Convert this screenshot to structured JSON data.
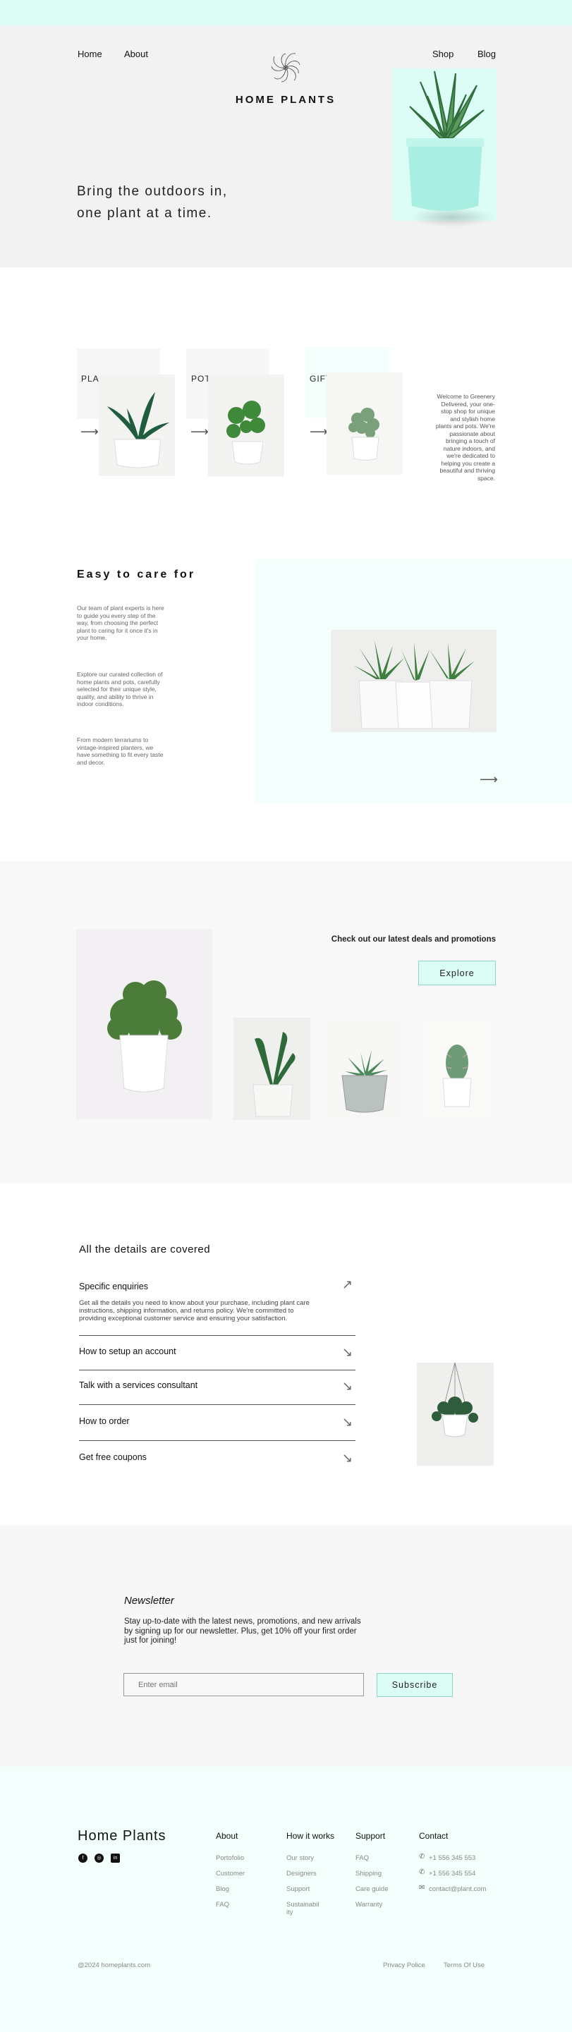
{
  "header": {
    "nav_left": [
      "Home",
      "About"
    ],
    "nav_right": [
      "Shop",
      "Blog"
    ],
    "brand": "HOME PLANTS",
    "tagline_line1": "Bring the outdoors in,",
    "tagline_line2": "one plant at a time."
  },
  "categories": [
    {
      "label": "PLANTS"
    },
    {
      "label": "POTS"
    },
    {
      "label": "GIFTS"
    }
  ],
  "welcome_text": "Welcome to Greenery Delivered, your one-stop shop for unique and stylish home plants and pots. We're passionate about bringing a touch of nature indoors, and we're dedicated to helping you create a beautiful and thriving space.",
  "care": {
    "title": "Easy to care for",
    "para1": "Our team of plant experts is here to guide you every step of the way, from choosing the perfect plant to caring for it once it's in your home.",
    "para2": "Explore our curated collection of home plants and pots, carefully selected for their unique style, quality, and ability to thrive in indoor conditions.",
    "para3": "From modern terrariums to vintage-inspired planters, we have something to fit every taste and decor."
  },
  "deals": {
    "title": "Check out our latest deals and promotions",
    "button": "Explore"
  },
  "details": {
    "title": "All the details are covered",
    "items": [
      {
        "title": "Specific enquiries",
        "body": "Get all the details you need to know about your purchase, including plant care instructions, shipping information, and returns policy. We're committed to providing exceptional customer service and ensuring your satisfaction."
      },
      {
        "title": "How to setup an account"
      },
      {
        "title": "Talk with a services consultant"
      },
      {
        "title": "How to order"
      },
      {
        "title": "Get free coupons"
      }
    ]
  },
  "newsletter": {
    "title": "Newsletter",
    "text": "Stay up-to-date with the latest news, promotions, and new arrivals by signing up for our newsletter. Plus, get 10% off your first order just for joining!",
    "placeholder": "Enter email",
    "button": "Subscribe"
  },
  "footer": {
    "logo_word1": "Home",
    "logo_word2": "Plants",
    "social": [
      "facebook-icon",
      "instagram-icon",
      "linkedin-icon"
    ],
    "columns": [
      {
        "heading": "About",
        "links": [
          "Portofolio",
          "Customer",
          "Blog",
          "FAQ"
        ]
      },
      {
        "heading": "How it works",
        "links": [
          "Our story",
          "Designers",
          "Support",
          "Sustainabil ity"
        ]
      },
      {
        "heading": "Support",
        "links": [
          "FAQ",
          "Shipping",
          "Care guide",
          "Warranty"
        ]
      }
    ],
    "contact": {
      "heading": "Contact",
      "phone1": "+1 556 345 553",
      "phone2": "+1 556 345 554",
      "email": "contact@plant.com"
    },
    "copyright": "@2024 homeplants.com",
    "legal": [
      "Privacy Police",
      "Terms Of Use"
    ]
  },
  "colors": {
    "accent": "#dcfdf6",
    "accent_border": "#8fd3c6",
    "hero_bg": "#f2f2f2"
  }
}
